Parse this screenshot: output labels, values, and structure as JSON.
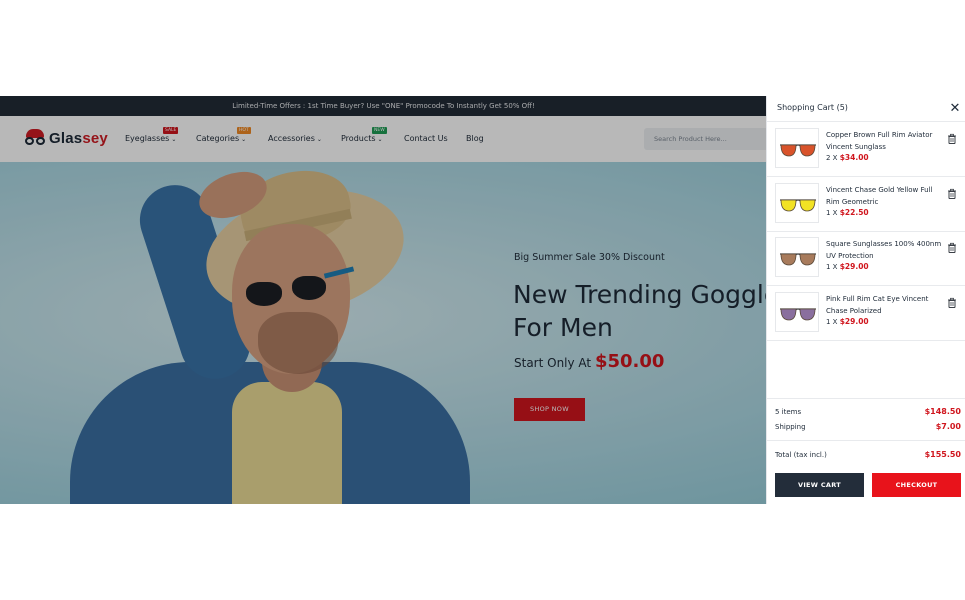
{
  "topbar": {
    "text": "Limited-Time Offers : 1st Time Buyer? Use \"ONE\" Promocode To Instantly Get 50% Off!"
  },
  "header": {
    "logo": {
      "part1": "Glas",
      "part2": "sey"
    },
    "nav": [
      {
        "label": "Eyeglasses",
        "badge": "SALE",
        "badge_color": "#d0161e"
      },
      {
        "label": "Categories",
        "badge": "HOT",
        "badge_color": "#f08a24"
      },
      {
        "label": "Accessories",
        "badge": "",
        "badge_color": ""
      },
      {
        "label": "Products",
        "badge": "NEW",
        "badge_color": "#1f9d55"
      },
      {
        "label": "Contact Us",
        "badge": "",
        "badge_color": ""
      },
      {
        "label": "Blog",
        "badge": "",
        "badge_color": ""
      }
    ],
    "search_placeholder": "Search Product Here..."
  },
  "hero": {
    "promo": "Big Summer Sale 30% Discount",
    "headline_line1": "New Trending Goggles",
    "headline_line2": "For Men",
    "start_label": "Start Only At ",
    "price": "$50.00",
    "cta": "SHOP NOW"
  },
  "cart": {
    "title": "Shopping Cart (5)",
    "items": [
      {
        "name": "Copper Brown Full Rim Aviator Vincent Sunglass",
        "qty": "2 X ",
        "price": "$34.00",
        "lens_color": "#d9532b"
      },
      {
        "name": "Vincent Chase Gold Yellow Full Rim Geometric",
        "qty": "1 X ",
        "price": "$22.50",
        "lens_color": "#f2e224"
      },
      {
        "name": "Square Sunglasses 100% 400nm UV Protection",
        "qty": "1 X ",
        "price": "$29.00",
        "lens_color": "#a87b5c"
      },
      {
        "name": "Pink Full Rim Cat Eye Vincent Chase Polarized",
        "qty": "1 X ",
        "price": "$29.00",
        "lens_color": "#8a6f9e"
      }
    ],
    "summary": {
      "items_label": "5 items",
      "items_value": "$148.50",
      "shipping_label": "Shipping",
      "shipping_value": "$7.00",
      "total_label": "Total (tax incl.)",
      "total_value": "$155.50"
    },
    "view_cart": "VIEW CART",
    "checkout": "CHECKOUT"
  },
  "colors": {
    "accent": "#d0161e",
    "dark": "#1e2a38"
  }
}
